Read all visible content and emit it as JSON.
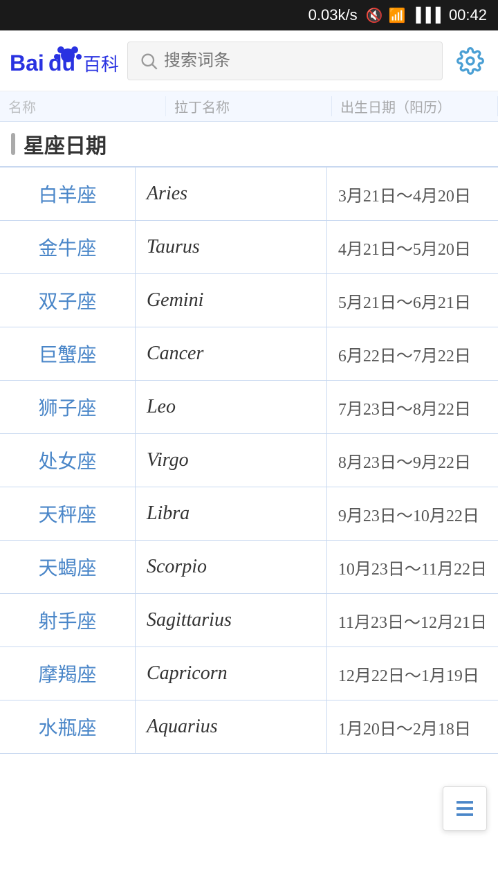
{
  "statusBar": {
    "speed": "0.03k/s",
    "time": "00:42"
  },
  "header": {
    "logo": "Bai du 百科",
    "searchPlaceholder": "搜索词条",
    "gearLabel": "设置"
  },
  "tableHeaders": [
    "名称",
    "拉丁名称",
    "出生日期（阳历）"
  ],
  "sectionTitle": "星座日期",
  "signs": [
    {
      "chinese": "白羊座",
      "latin": "Aries",
      "dates": "3月21日～4月20日"
    },
    {
      "chinese": "金牛座",
      "latin": "Taurus",
      "dates": "4月21日～5月20日"
    },
    {
      "chinese": "双子座",
      "latin": "Gemini",
      "dates": "5月21日～6月21日"
    },
    {
      "chinese": "巨蟹座",
      "latin": "Cancer",
      "dates": "6月22日～7月22日"
    },
    {
      "chinese": "狮子座",
      "latin": "Leo",
      "dates": "7月23日～8月22日"
    },
    {
      "chinese": "处女座",
      "latin": "Virgo",
      "dates": "8月23日～9月22日"
    },
    {
      "chinese": "天秤座",
      "latin": "Libra",
      "dates": "9月23日～10月22日"
    },
    {
      "chinese": "天蝎座",
      "latin": "Scorpio",
      "dates": "10月23日～11月22日"
    },
    {
      "chinese": "射手座",
      "latin": "Sagittarius",
      "dates": "11月23日～12月21日"
    },
    {
      "chinese": "摩羯座",
      "latin": "Capricorn",
      "dates": "12月22日～1月19日"
    },
    {
      "chinese": "水瓶座",
      "latin": "Aquarius",
      "dates": "1月20日～2月18日"
    }
  ],
  "floatMenu": "菜单"
}
